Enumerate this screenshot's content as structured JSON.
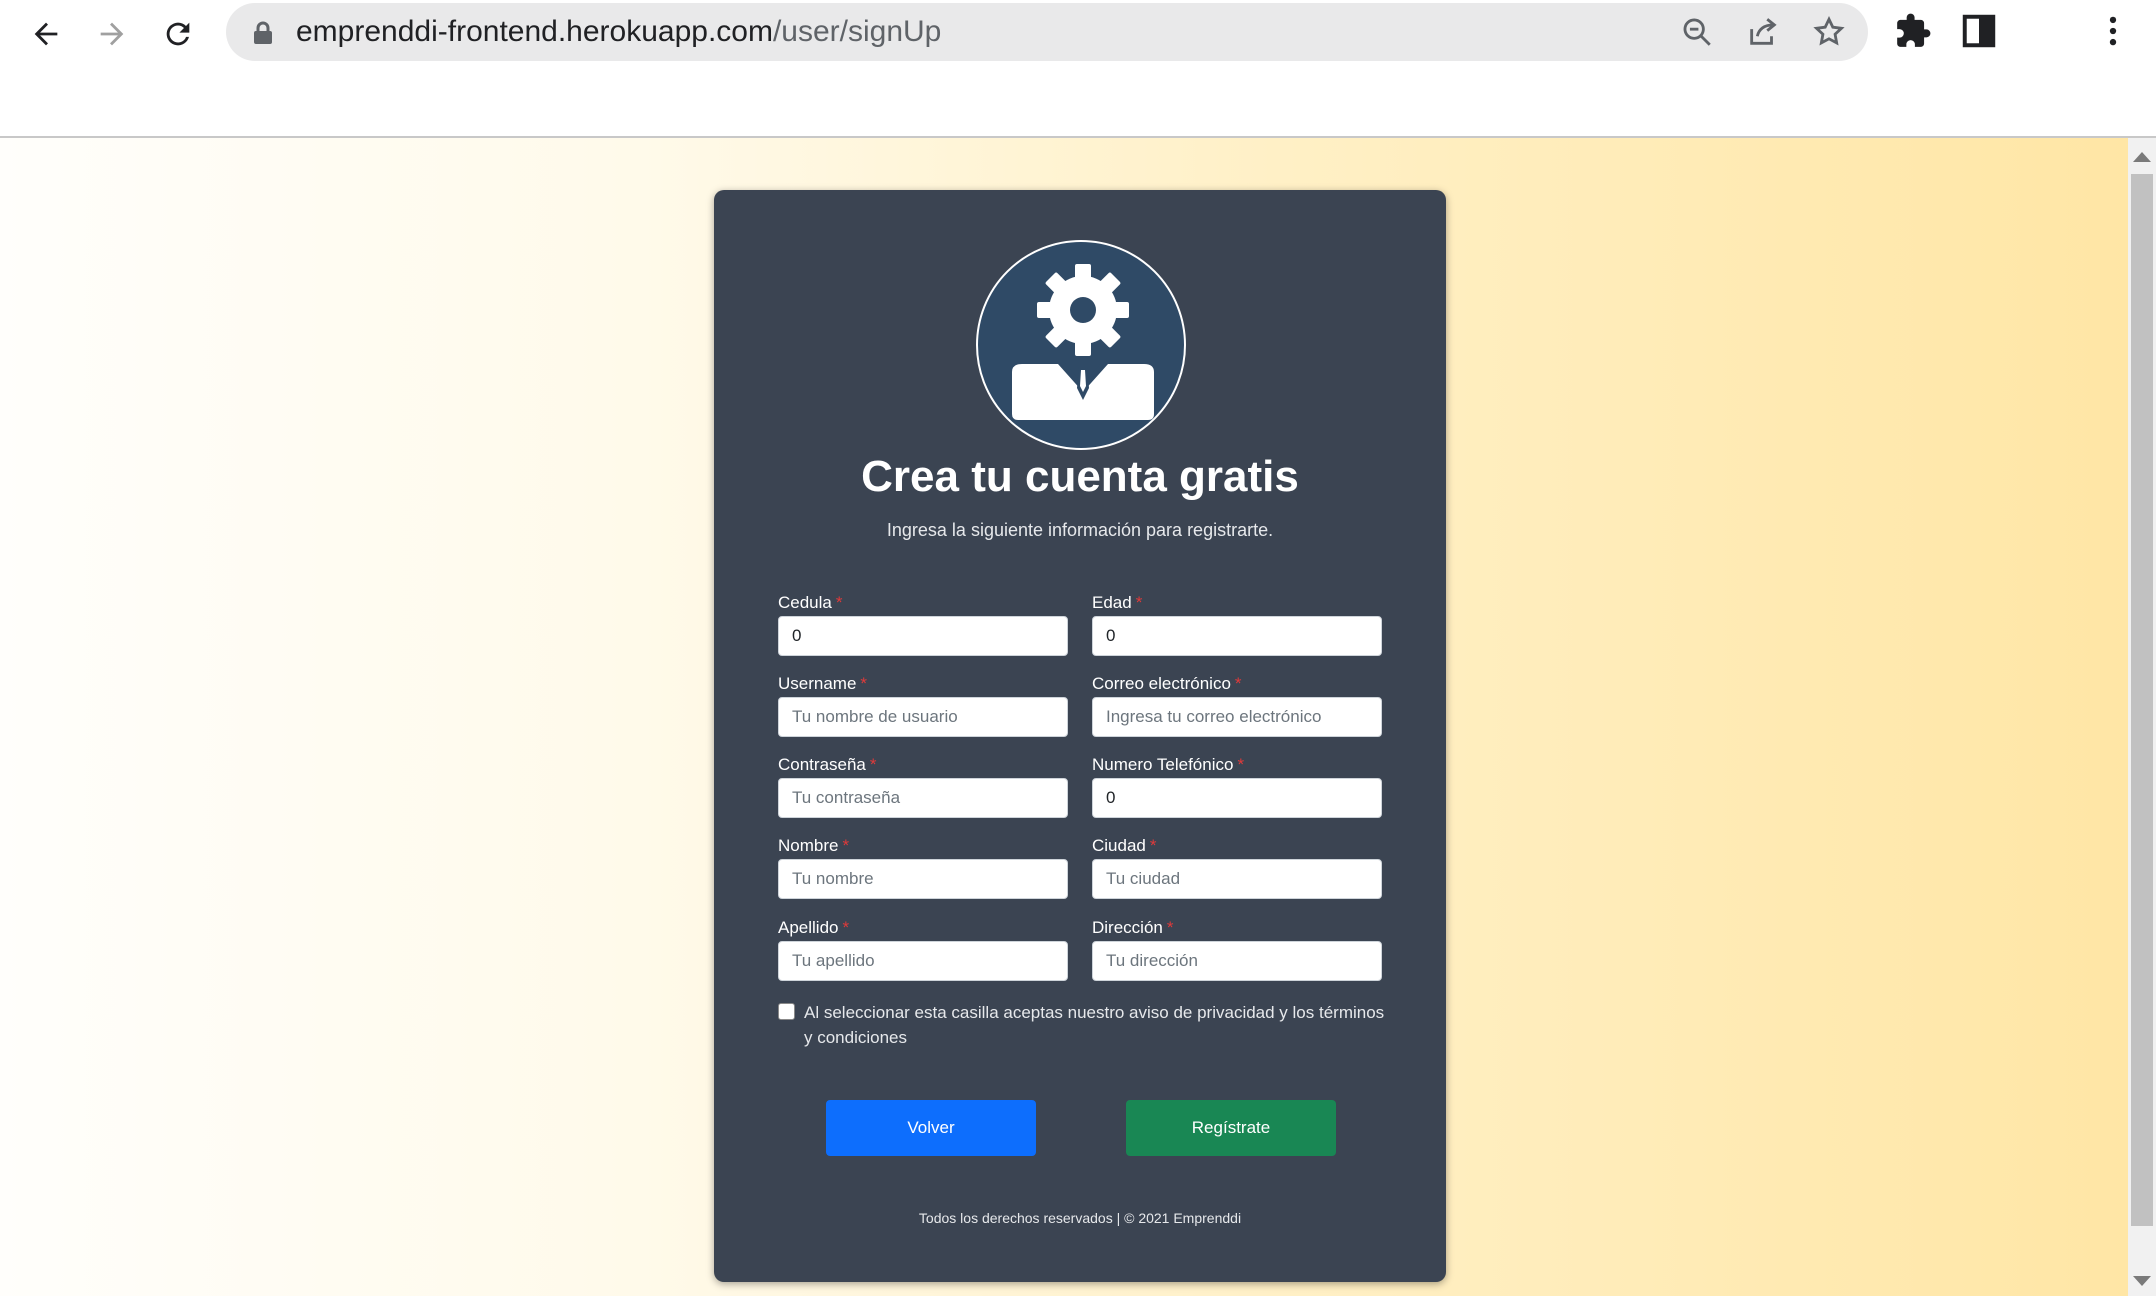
{
  "browser": {
    "url_host": "emprenddi-frontend.herokuapp.com",
    "url_path": "/user/signUp",
    "icons": [
      "back-arrow-icon",
      "forward-arrow-icon",
      "reload-icon",
      "lock-icon",
      "zoom-icon",
      "share-icon",
      "star-icon",
      "extensions-icon",
      "sidepanel-icon",
      "menu-dots-icon"
    ]
  },
  "card": {
    "title": "Crea tu cuenta gratis",
    "subtitle": "Ingresa la siguiente información para registrarte.",
    "avatar_icon": "businessman-gear-icon"
  },
  "form": {
    "required_mark": "*",
    "fields": [
      {
        "label": "Cedula",
        "value": "0",
        "placeholder": ""
      },
      {
        "label": "Edad",
        "value": "0",
        "placeholder": ""
      },
      {
        "label": "Username",
        "value": "",
        "placeholder": "Tu nombre de usuario"
      },
      {
        "label": "Correo electrónico",
        "value": "",
        "placeholder": "Ingresa tu correo electrónico"
      },
      {
        "label": "Contraseña",
        "value": "",
        "placeholder": "Tu contraseña"
      },
      {
        "label": "Numero Telefónico",
        "value": "0",
        "placeholder": ""
      },
      {
        "label": "Nombre",
        "value": "",
        "placeholder": "Tu nombre"
      },
      {
        "label": "Ciudad",
        "value": "",
        "placeholder": "Tu ciudad"
      },
      {
        "label": "Apellido",
        "value": "",
        "placeholder": "Tu apellido"
      },
      {
        "label": "Dirección",
        "value": "",
        "placeholder": "Tu dirección"
      }
    ],
    "terms_text": "Al seleccionar esta casilla aceptas nuestro aviso de privacidad y los términos y condiciones",
    "terms_checked": false,
    "back_label": "Volver",
    "register_label": "Regístrate"
  },
  "footer": {
    "text": "Todos los derechos reservados | © 2021 Emprenddi"
  },
  "colors": {
    "card": "#3b4452",
    "primary": "#0d6efd",
    "success": "#198754",
    "required": "#e03a3a"
  }
}
